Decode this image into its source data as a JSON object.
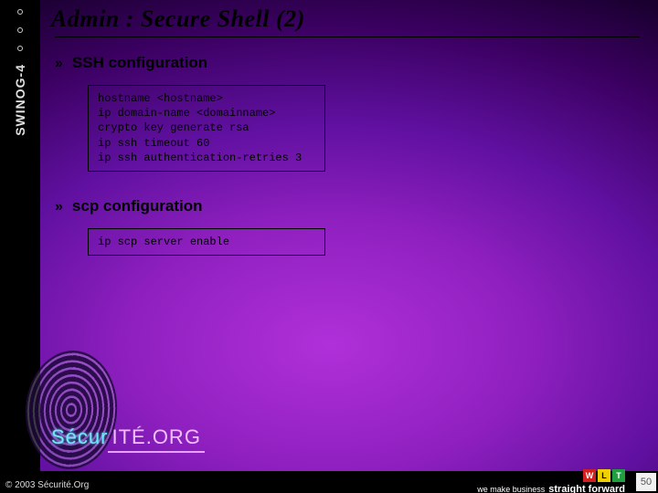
{
  "rail": {
    "label": "SWINOG-4"
  },
  "title": "Admin : Secure Shell (2)",
  "section1": {
    "label": "SSH configuration",
    "code": "hostname <hostname>\nip domain-name <domainname>\ncrypto key generate rsa\nip ssh timeout 60\nip ssh authentication-retries 3"
  },
  "section2": {
    "label": "scp configuration",
    "code": "ip scp server enable"
  },
  "logo": {
    "prefix": "Sécur",
    "suffix": "ITÉ.ORG"
  },
  "footer": {
    "copyright": "© 2003 Sécurité.Org",
    "wlt": {
      "w": "W",
      "l": "L",
      "t": "T"
    },
    "tag1": "we make business",
    "tag2": "straight forward",
    "page": "50"
  }
}
